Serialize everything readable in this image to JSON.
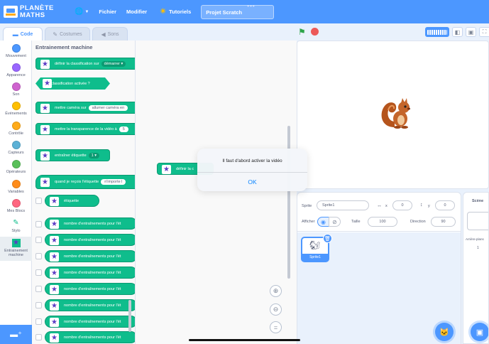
{
  "menubar": {
    "logo_line1": "PLANÈTE",
    "logo_line2": "MATHS",
    "file": "Fichier",
    "edit": "Modifier",
    "tutorials": "Tutoriels",
    "project_title": "Projet Scratch",
    "dots": "•••"
  },
  "tabs": {
    "code": "Code",
    "costumes": "Costumes",
    "sounds": "Sons"
  },
  "categories": [
    {
      "label": "Mouvement",
      "color": "#4c97ff"
    },
    {
      "label": "Apparence",
      "color": "#9966ff"
    },
    {
      "label": "Son",
      "color": "#cf63cf"
    },
    {
      "label": "Événements",
      "color": "#ffbf00"
    },
    {
      "label": "Contrôle",
      "color": "#ffab19"
    },
    {
      "label": "Capteurs",
      "color": "#5cb1d6"
    },
    {
      "label": "Opérateurs",
      "color": "#59c059"
    },
    {
      "label": "Variables",
      "color": "#ff8c1a"
    },
    {
      "label": "Mes Blocs",
      "color": "#ff6680"
    },
    {
      "label": "Stylo"
    },
    {
      "label1": "Entrainement",
      "label2": "machine"
    }
  ],
  "palette": {
    "title": "Entrainement machine",
    "blocks": {
      "b1": "définir la classification sur",
      "b1_field": "démarrer ▾",
      "b2": "classification activée ?",
      "b3": "mettre caméra sur",
      "b3_field": "allumer caméra en",
      "b4": "mettre la transparence de la vidéo à",
      "b4_field": "5",
      "b5": "entraîner étiquette",
      "b5_field": "1 ▾",
      "b6": "quand je reçois l'étiquette",
      "b6_field": "n'importe l",
      "b7": "étiquette",
      "count": "nombre d'entraînements pour l'ét"
    }
  },
  "scripts": {
    "block": "définir la c"
  },
  "dialog": {
    "message": "Il faut d'abord activer la vidéo",
    "ok": "OK"
  },
  "sprite_info": {
    "sprite_label": "Sprite",
    "sprite_name": "Sprite1",
    "x_label": "x",
    "x_value": "0",
    "y_label": "y",
    "y_value": "0",
    "show_label": "Afficher",
    "size_label": "Taille",
    "size_value": "100",
    "direction_label": "Direction",
    "direction_value": "90"
  },
  "sprite_list": {
    "thumb_name": "Sprite1"
  },
  "stage_pane": {
    "title": "Scène",
    "backdrops_label": "Arrière-plans",
    "backdrops_count": "1"
  },
  "colors": {
    "accent": "#4c97ff",
    "extension_green": "#0fbd8c"
  }
}
